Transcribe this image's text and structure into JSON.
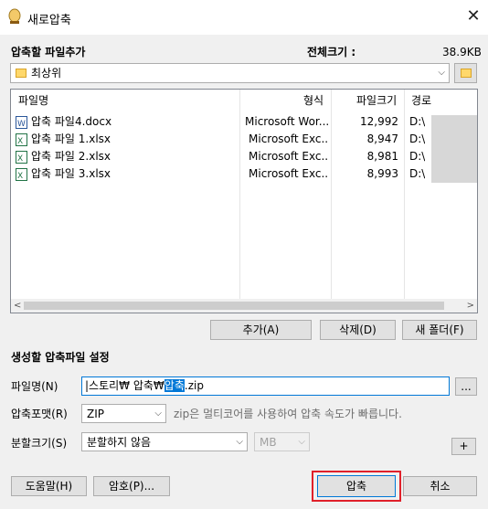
{
  "window": {
    "title": "새로압축",
    "close_glyph": "✕"
  },
  "top": {
    "section_label": "압축할 파일추가",
    "total_size_label": "전체크기 :",
    "total_size_value": "38.9KB",
    "location_value": "최상위"
  },
  "list": {
    "columns": [
      "파일명",
      "형식",
      "파일크기",
      "경로"
    ],
    "rows": [
      {
        "name": "압축 파일4.docx",
        "type": "Microsoft Wor...",
        "size": "12,992",
        "path": "D:\\",
        "icon": "word-doc-icon"
      },
      {
        "name": "압축 파일 1.xlsx",
        "type": "Microsoft Exc...",
        "size": "8,947",
        "path": "D:\\",
        "icon": "excel-doc-icon"
      },
      {
        "name": "압축 파일 2.xlsx",
        "type": "Microsoft Exc...",
        "size": "8,981",
        "path": "D:\\",
        "icon": "excel-doc-icon"
      },
      {
        "name": "압축 파일 3.xlsx",
        "type": "Microsoft Exc...",
        "size": "8,993",
        "path": "D:\\",
        "icon": "excel-doc-icon"
      }
    ]
  },
  "list_buttons": {
    "add": "추가(A)",
    "delete": "삭제(D)",
    "new_folder": "새 폴더(F)"
  },
  "settings": {
    "section_label": "생성할 압축파일 설정",
    "filename_label": "파일명(N)",
    "filename_prefix": "|스토리₩ 압축₩",
    "filename_selected": "압축",
    "filename_suffix": ".zip",
    "browse_label": "...",
    "format_label": "압축포맷(R)",
    "format_value": "ZIP",
    "format_hint": "zip은 멀티코어를 사용하여 압축 속도가 빠릅니다.",
    "split_label": "분할크기(S)",
    "split_value": "분할하지 않음",
    "split_unit": "MB",
    "plus_label": "+"
  },
  "bottom": {
    "help": "도움말(H)",
    "password": "암호(P)...",
    "compress": "압축",
    "cancel": "취소"
  },
  "colors": {
    "accent": "#0078d7",
    "highlight_border": "#e0202a"
  }
}
